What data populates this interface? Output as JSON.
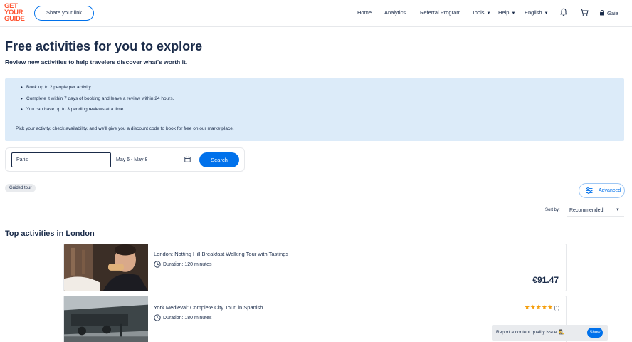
{
  "header": {
    "logo_lines": [
      "GET",
      "YOUR",
      "GUIDE"
    ],
    "share_label": "Share your link",
    "nav": {
      "home": "Home",
      "analytics": "Analytics",
      "referral": "Referral Program",
      "tools": "Tools",
      "help": "Help",
      "language": "English",
      "user": "Gaia"
    },
    "icons": [
      "bell-icon",
      "cart-icon",
      "lock-user-icon"
    ]
  },
  "page": {
    "title": "Free activities for you to explore",
    "subtitle": "Review new activities to help travelers discover what's worth it."
  },
  "info": {
    "bullets": [
      "Book up to 2 people per activity",
      "Complete it within 7 days of booking and leave a review within 24 hours.",
      "You can have up to 3 pending reviews at a time."
    ],
    "footer": "Pick your activity, check availability, and we'll give you a discount code to book for free on our marketplace."
  },
  "search": {
    "location_value": "Paris",
    "date_range": "May 6 - May 8",
    "button_label": "Search"
  },
  "filters": {
    "chip": "Guided tour",
    "advanced_label": "Advanced",
    "sort_label": "Sort by:",
    "sort_value": "Recommended"
  },
  "section": {
    "title": "Top activities in London"
  },
  "activities": [
    {
      "title": "London: Notting Hill Breakfast Walking Tour with Tastings",
      "duration": "Duration: 120 minutes",
      "price": "€91.47"
    },
    {
      "title": "York Medieval: Complete City Tour, in Spanish",
      "duration": "Duration: 180 minutes",
      "rating_count": "(1)",
      "rating_stars": 5
    }
  ],
  "report": {
    "label": "Report a content quality issue",
    "emoji": "🕵️",
    "show_label": "Show"
  },
  "colors": {
    "brand": "#ff5533",
    "accent": "#0071eb",
    "info_bg": "#dcebf9",
    "text": "#1a2b49"
  }
}
